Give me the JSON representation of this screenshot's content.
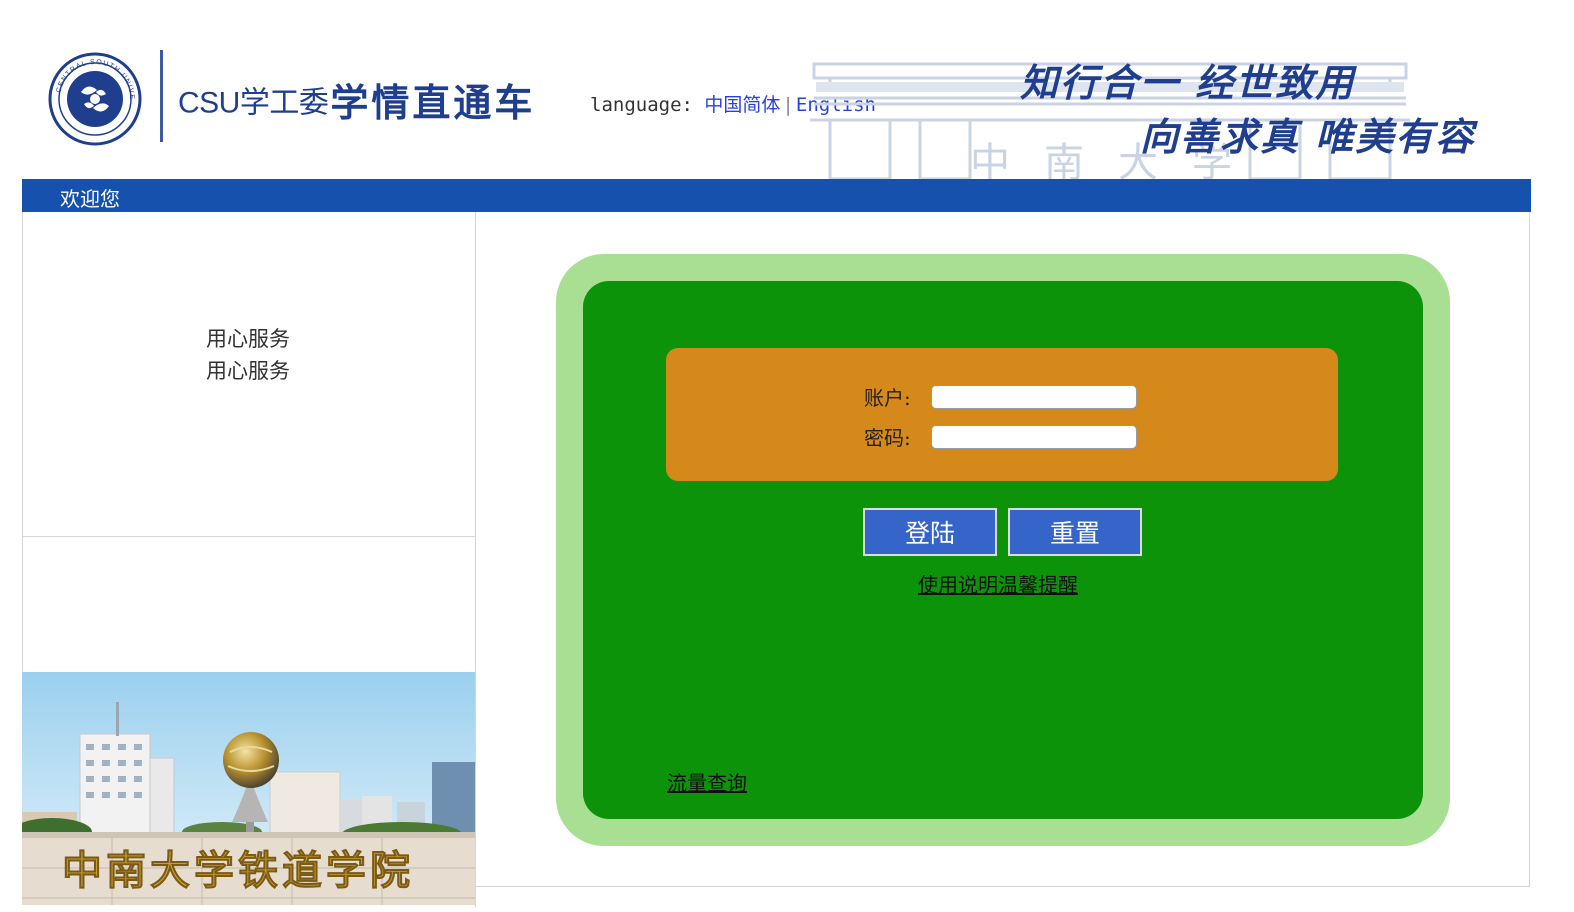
{
  "header": {
    "brand_csu": "CSU学工委",
    "brand_name": "学情直通车",
    "language_label": "language:",
    "lang_options": [
      "中国简体",
      "English"
    ],
    "motto_line1": "知行合一  经世致用",
    "motto_line2": "向善求真  唯美有容",
    "watermark": "中南大学",
    "logo_text": "CENTRAL SOUTH UNIVERSITY"
  },
  "navbar": {
    "welcome": "欢迎您"
  },
  "sidebar": {
    "service_lines": [
      "用心服务",
      "用心服务"
    ],
    "campus_sign": "中南大学铁道学院"
  },
  "login": {
    "account_label": "账户:",
    "password_label": "密码:",
    "account_value": "",
    "password_value": "",
    "login_button": "登陆",
    "reset_button": "重置",
    "help_link": "使用说明温馨提醒",
    "traffic_link": "流量查询"
  },
  "colors": {
    "nav_blue": "#1551ad",
    "outer_panel": "#a9df93",
    "inner_panel": "#0d930a",
    "form_box": "#d5891b",
    "button_blue": "#3565c9",
    "brand_blue": "#1f3f8e"
  }
}
